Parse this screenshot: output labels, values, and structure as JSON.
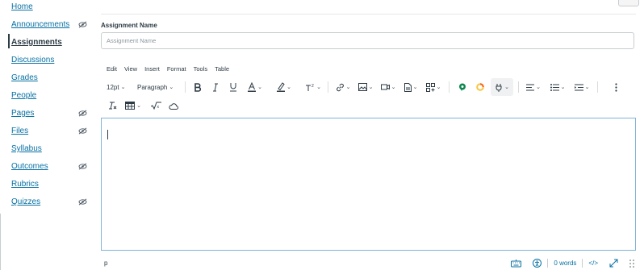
{
  "sidebar": {
    "items": [
      {
        "label": "Home",
        "hidden": false
      },
      {
        "label": "Announcements",
        "hidden": true
      },
      {
        "label": "Assignments",
        "hidden": false,
        "active": true
      },
      {
        "label": "Discussions",
        "hidden": false
      },
      {
        "label": "Grades",
        "hidden": false
      },
      {
        "label": "People",
        "hidden": false
      },
      {
        "label": "Pages",
        "hidden": true
      },
      {
        "label": "Files",
        "hidden": true
      },
      {
        "label": "Syllabus",
        "hidden": false
      },
      {
        "label": "Outcomes",
        "hidden": true
      },
      {
        "label": "Rubrics",
        "hidden": false
      },
      {
        "label": "Quizzes",
        "hidden": true
      }
    ]
  },
  "form": {
    "name_label": "Assignment Name",
    "name_placeholder": "Assignment Name",
    "name_value": ""
  },
  "editor": {
    "menubar": [
      "Edit",
      "View",
      "Insert",
      "Format",
      "Tools",
      "Table"
    ],
    "font_size": "12pt",
    "block_format": "Paragraph",
    "content": "",
    "status_path": "p",
    "word_count": "0 words",
    "html_toggle": "</>"
  },
  "colors": {
    "link": "#0770a3",
    "text": "#2d3b45",
    "editor_border": "#7fb4d8",
    "green_icon": "#0b874b",
    "orange_icon": "#fc5e13",
    "yellow_icon": "#f9c53c"
  }
}
